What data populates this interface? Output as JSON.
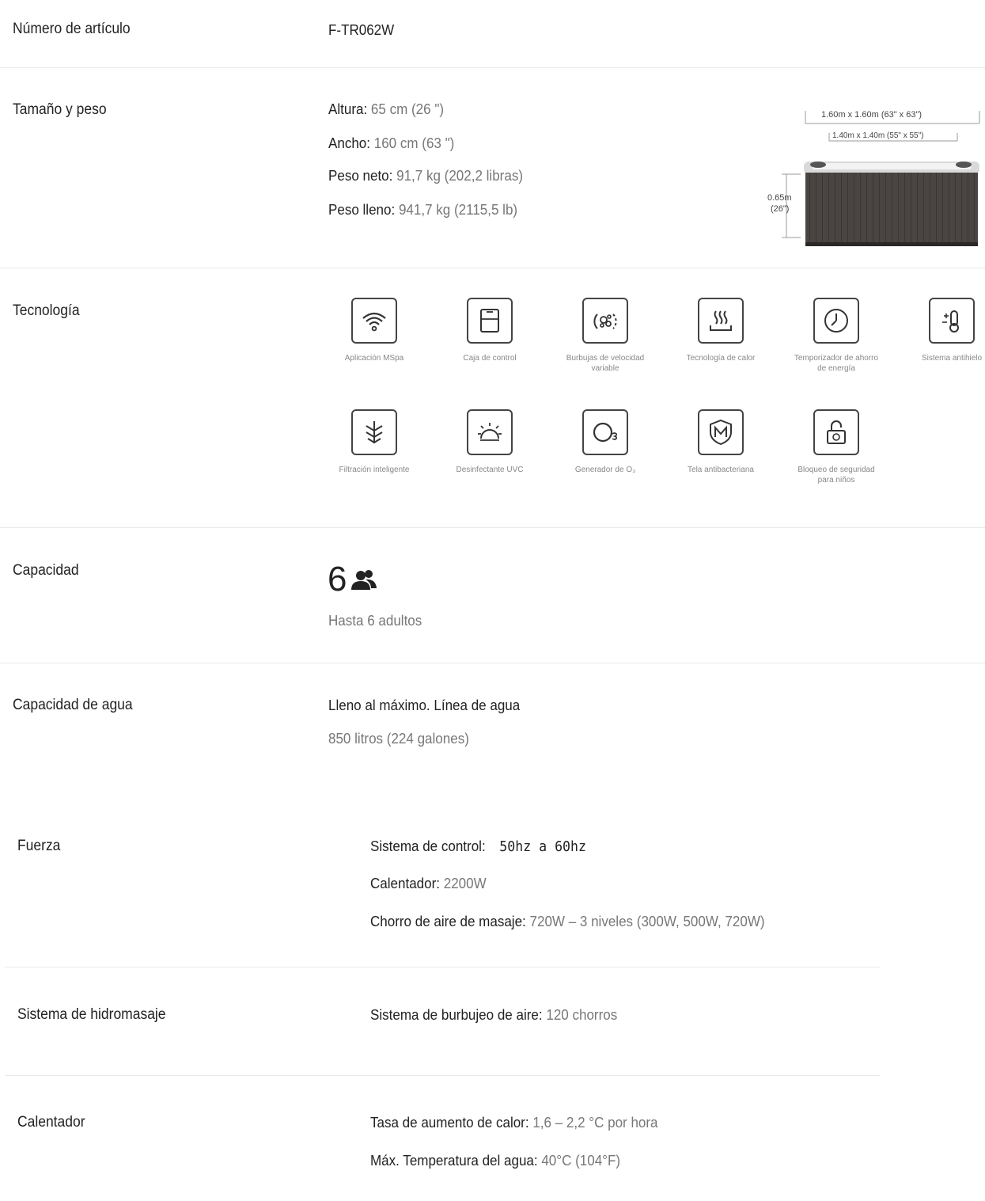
{
  "article": {
    "label": "Número de artículo",
    "value": "F-TR062W"
  },
  "size_weight": {
    "label": "Tamaño y peso",
    "rows": [
      {
        "k": "Altura:",
        "v": "65 cm (26 \")"
      },
      {
        "k": "Ancho:",
        "v": "160 cm (63 \")"
      },
      {
        "k": "Peso neto:",
        "v": "91,7 kg (202,2 libras)"
      },
      {
        "k": "Peso lleno:",
        "v": "941,7 kg (2115,5 lb)"
      }
    ],
    "diagram": {
      "outer": "1.60m x 1.60m (63\" x 63\")",
      "inner": "1.40m x 1.40m (55\" x 55\")",
      "height": "0.65m",
      "height_in": "(26\")"
    }
  },
  "technology": {
    "label": "Tecnología",
    "items": [
      {
        "icon": "wifi-icon",
        "caption": "Aplicación MSpa"
      },
      {
        "icon": "control-box-icon",
        "caption": "Caja de control"
      },
      {
        "icon": "bubbles-icon",
        "caption": "Burbujas de velocidad variable"
      },
      {
        "icon": "heat-icon",
        "caption": "Tecnología de calor"
      },
      {
        "icon": "clock-icon",
        "caption": "Temporizador de ahorro de energía"
      },
      {
        "icon": "thermometer-icon",
        "caption": "Sistema antihielo"
      },
      {
        "icon": "filter-icon",
        "caption": "Filtración inteligente"
      },
      {
        "icon": "uvc-icon",
        "caption": "Desinfectante UVC"
      },
      {
        "icon": "ozone-icon",
        "caption": "Generador de O₃"
      },
      {
        "icon": "shield-icon",
        "caption": "Tela antibacteriana"
      },
      {
        "icon": "lock-icon",
        "caption": "Bloqueo de seguridad para niños"
      }
    ]
  },
  "capacity": {
    "label": "Capacidad",
    "number": "6",
    "icon": "people-icon",
    "desc": "Hasta 6 adultos"
  },
  "water": {
    "label": "Capacidad de agua",
    "title": "Lleno al máximo. Línea de agua",
    "value": "850 litros (224 galones)"
  },
  "power": {
    "label": "Fuerza",
    "control_k": "Sistema de control:",
    "control_v": "50hz a 60hz",
    "heater_k": "Calentador:",
    "heater_v": "2200W",
    "jet_k": "Chorro de aire de masaje:",
    "jet_v": "720W – 3 niveles (300W, 500W, 720W)"
  },
  "hydro": {
    "label": "Sistema de hidromasaje",
    "k": "Sistema de burbujeo de aire:",
    "v": "120 chorros"
  },
  "heater": {
    "label": "Calentador",
    "rate_k": "Tasa de aumento de calor:",
    "rate_v": "1,6 – 2,2 °C por hora",
    "max_k": "Máx. Temperatura del agua:",
    "max_v": "40°C (104°F)"
  }
}
